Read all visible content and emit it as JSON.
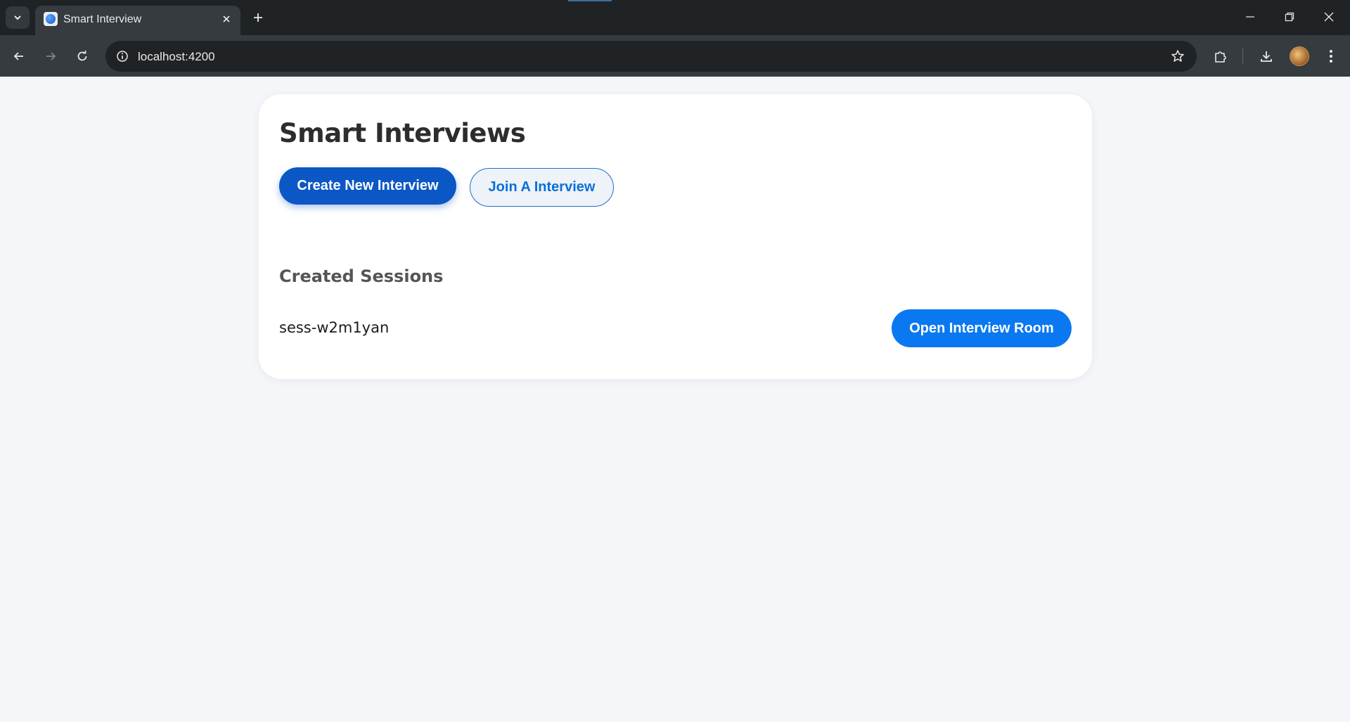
{
  "browser": {
    "tab_title": "Smart Interview",
    "url": "localhost:4200"
  },
  "page": {
    "title": "Smart Interviews",
    "create_button": "Create New Interview",
    "join_button": "Join A Interview",
    "sessions_title": "Created Sessions",
    "sessions": [
      {
        "id": "sess-w2m1yan",
        "action": "Open Interview Room"
      }
    ]
  },
  "colors": {
    "primary": "#0b57c5",
    "open_button": "#0a78f0",
    "page_background": "#f4f6f9"
  }
}
